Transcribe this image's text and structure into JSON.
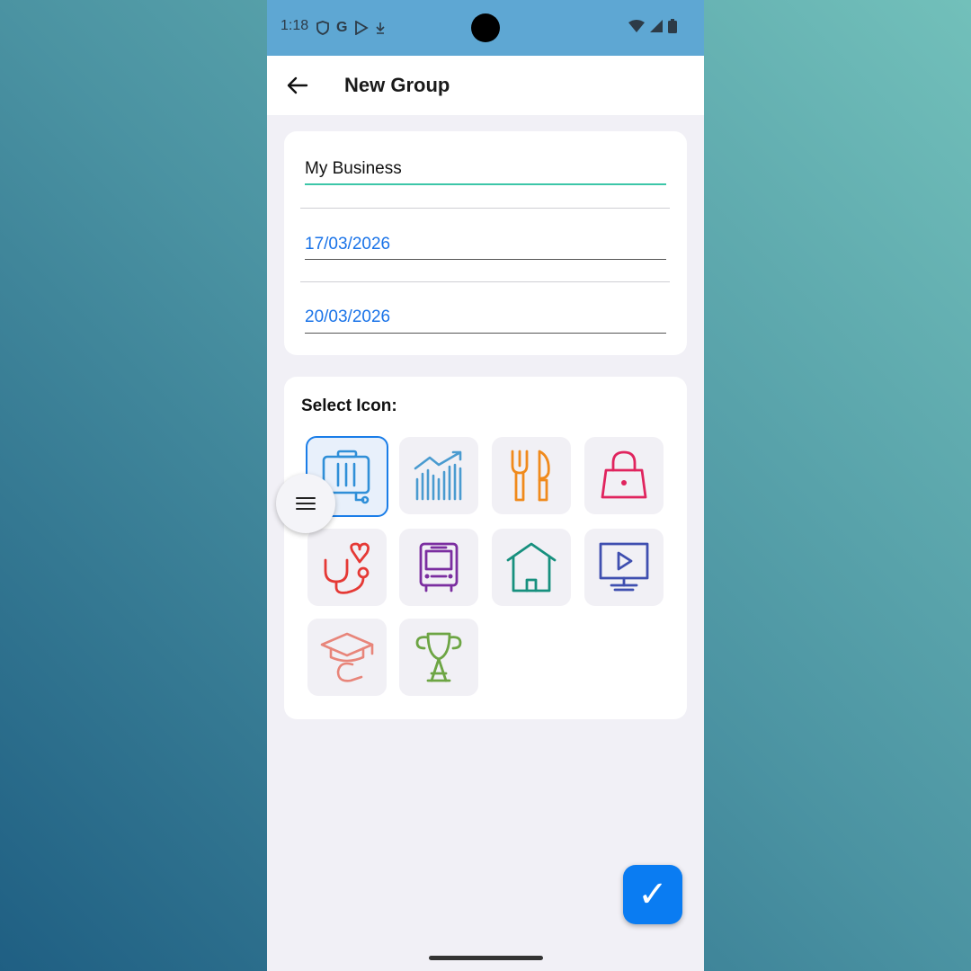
{
  "status_bar": {
    "time": "1:18"
  },
  "app_bar": {
    "title": "New Group"
  },
  "form": {
    "name_value": "My Business",
    "start_date": "17/03/2026",
    "end_date": "20/03/2026"
  },
  "icon_section": {
    "label": "Select Icon:",
    "icons": [
      {
        "name": "luggage-icon",
        "color": "#2f8fd8",
        "selected": true
      },
      {
        "name": "chart-icon",
        "color": "#4a9bd0",
        "selected": false
      },
      {
        "name": "restaurant-icon",
        "color": "#f08a1c",
        "selected": false
      },
      {
        "name": "shopping-bag-icon",
        "color": "#e0245e",
        "selected": false
      },
      {
        "name": "health-icon",
        "color": "#e53935",
        "selected": false
      },
      {
        "name": "bus-icon",
        "color": "#7b2ea0",
        "selected": false
      },
      {
        "name": "home-icon",
        "color": "#17907e",
        "selected": false
      },
      {
        "name": "tv-icon",
        "color": "#3f4fb0",
        "selected": false
      },
      {
        "name": "education-icon",
        "color": "#e8857a",
        "selected": false
      },
      {
        "name": "trophy-icon",
        "color": "#6da544",
        "selected": false
      }
    ]
  },
  "colors": {
    "accent": "#0a7cf2",
    "name_underline": "#3cc6a8",
    "date_text": "#1a73e8",
    "status_bar": "#5ea7d3"
  }
}
